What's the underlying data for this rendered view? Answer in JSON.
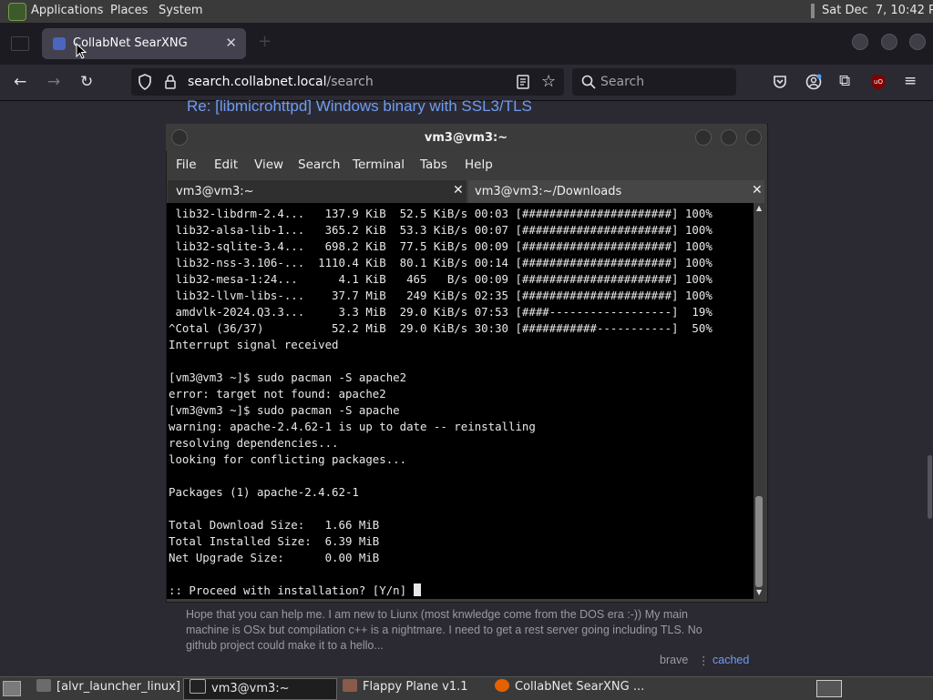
{
  "top_panel": {
    "menus": [
      "Applications",
      "Places",
      "System"
    ],
    "clock": "Sat Dec  7, 10:42 PM"
  },
  "browser": {
    "tab_title": "CollabNet SearXNG",
    "url_domain": "search.collabnet.local",
    "url_path": "/search",
    "search_placeholder": "Search",
    "icons": [
      "back-icon",
      "forward-icon",
      "reload-icon",
      "shield-icon",
      "lock-icon",
      "reader-view-icon",
      "bookmark-star-icon",
      "search-icon",
      "pocket-icon",
      "account-icon",
      "extensions-icon",
      "ublock-icon",
      "hamburger-menu-icon"
    ]
  },
  "page": {
    "result_title": "Re: [libmicrohttpd] Windows binary with SSL3/TLS",
    "snippet": "Hope that you can help me. I am new to Liunx (most knwledge come from the DOS era :-)) My main machine is OSx but compilation c++ is a nightmare. I need to get a rest server going including TLS. No github project could make it to a hello...",
    "engine": "brave",
    "separator": "⋮",
    "cached_label": "cached"
  },
  "terminal": {
    "title": "vm3@vm3:~",
    "menus": [
      "File",
      "Edit",
      "View",
      "Search",
      "Terminal",
      "Tabs",
      "Help"
    ],
    "tabs": [
      "vm3@vm3:~",
      "vm3@vm3:~/Downloads"
    ],
    "lines": [
      " lib32-libdrm-2.4...   137.9 KiB  52.5 KiB/s 00:03 [######################] 100%",
      " lib32-alsa-lib-1...   365.2 KiB  53.3 KiB/s 00:07 [######################] 100%",
      " lib32-sqlite-3.4...   698.2 KiB  77.5 KiB/s 00:09 [######################] 100%",
      " lib32-nss-3.106-...  1110.4 KiB  80.1 KiB/s 00:14 [######################] 100%",
      " lib32-mesa-1:24...      4.1 KiB   465   B/s 00:09 [######################] 100%",
      " lib32-llvm-libs-...    37.7 MiB   249 KiB/s 02:35 [######################] 100%",
      " amdvlk-2024.Q3.3...     3.3 MiB  29.0 KiB/s 07:53 [####------------------]  19%",
      "^Cotal (36/37)          52.2 MiB  29.0 KiB/s 30:30 [###########-----------]  50%",
      "Interrupt signal received",
      "",
      "[vm3@vm3 ~]$ sudo pacman -S apache2",
      "error: target not found: apache2",
      "[vm3@vm3 ~]$ sudo pacman -S apache",
      "warning: apache-2.4.62-1 is up to date -- reinstalling",
      "resolving dependencies...",
      "looking for conflicting packages...",
      "",
      "Packages (1) apache-2.4.62-1",
      "",
      "Total Download Size:   1.66 MiB",
      "Total Installed Size:  6.39 MiB",
      "Net Upgrade Size:      0.00 MiB",
      "",
      ":: Proceed with installation? [Y/n] "
    ]
  },
  "taskbar": {
    "items": [
      "[alvr_launcher_linux]",
      "vm3@vm3:~",
      "Flappy Plane v1.1",
      "CollabNet SearXNG ..."
    ]
  }
}
